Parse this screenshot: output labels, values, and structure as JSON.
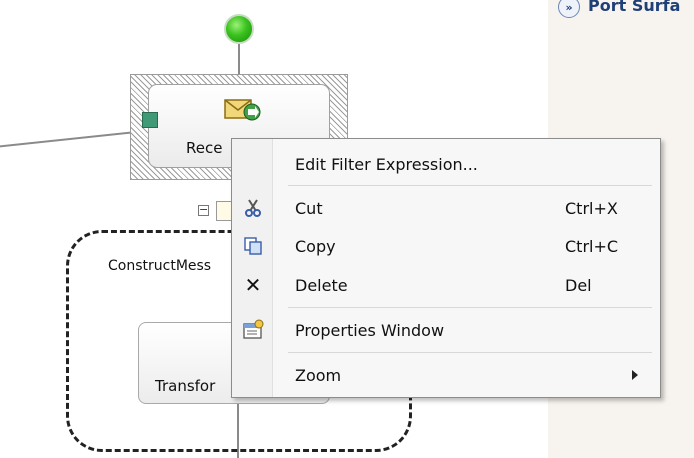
{
  "designer": {
    "receive_shape_label": "Rece",
    "construct_shape_label": "ConstructMess",
    "transform_shape_label": "Transfor"
  },
  "port_surface": {
    "expand_glyph": "»",
    "title": "Port Surfa"
  },
  "context_menu": {
    "items": [
      {
        "label": "Edit Filter Expression...",
        "shortcut": "",
        "icon": ""
      },
      {
        "label": "Cut",
        "shortcut": "Ctrl+X",
        "icon": "scissors-icon"
      },
      {
        "label": "Copy",
        "shortcut": "Ctrl+C",
        "icon": "copy-icon"
      },
      {
        "label": "Delete",
        "shortcut": "Del",
        "icon": "delete-icon",
        "glyph": "✕"
      },
      {
        "label": "Properties Window",
        "shortcut": "",
        "icon": "properties-window-icon"
      },
      {
        "label": "Zoom",
        "shortcut": "",
        "icon": "",
        "has_submenu": true
      }
    ]
  },
  "colors": {
    "start_green": "#39c21d",
    "port_connector": "#3f9a75",
    "panel_bg": "#f7f3ee",
    "panel_title": "#1f3f77"
  }
}
